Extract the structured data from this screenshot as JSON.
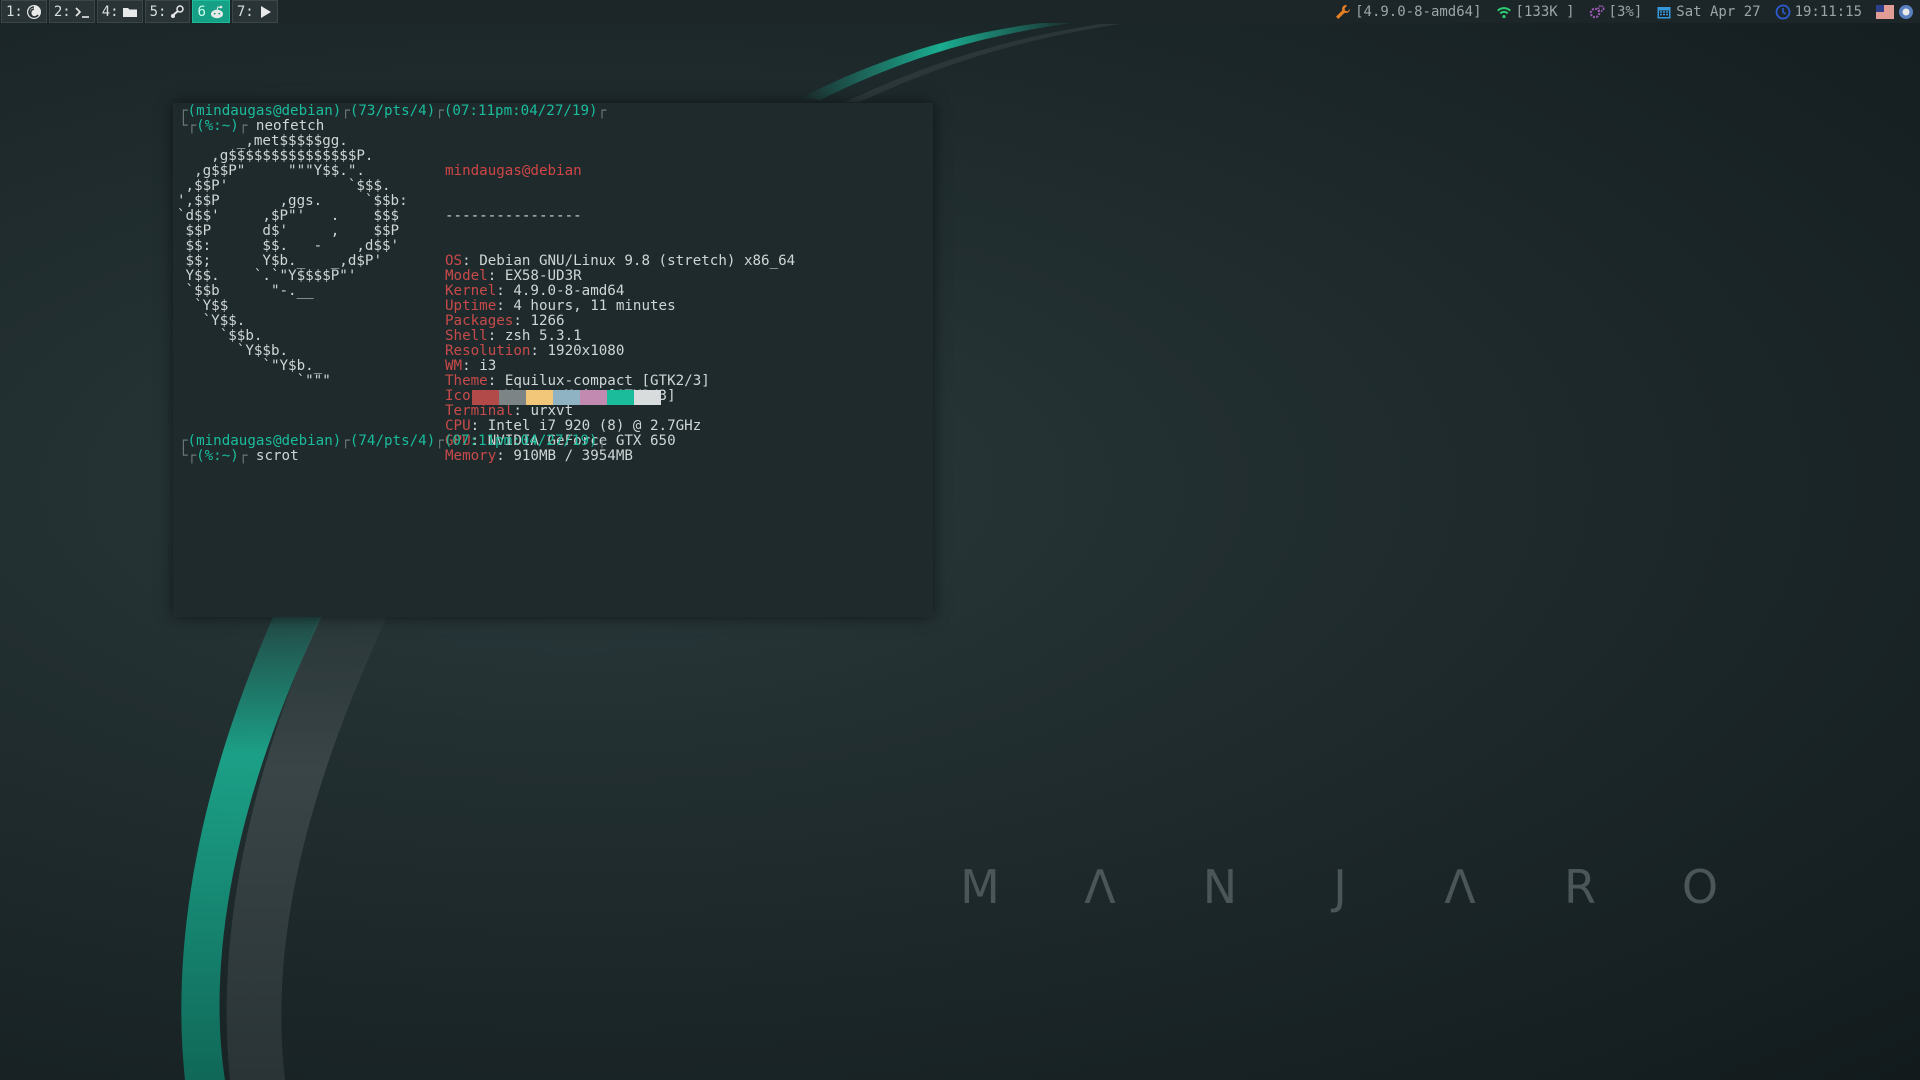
{
  "bar": {
    "workspaces": [
      {
        "label": "1:",
        "icon": "debian-swirl-icon",
        "active": false
      },
      {
        "label": "2:",
        "icon": "terminal-prompt-icon",
        "active": false
      },
      {
        "label": "4:",
        "icon": "folder-icon",
        "active": false
      },
      {
        "label": "5:",
        "icon": "steam-icon",
        "active": false
      },
      {
        "label": "6",
        "icon": "reddit-icon",
        "active": true
      },
      {
        "label": "7:",
        "icon": "play-icon",
        "active": false
      }
    ],
    "status": {
      "kernel": "[4.9.0-8-amd64]",
      "wifi": "[133K ]",
      "cpu": "[3%]",
      "date": "Sat Apr 27",
      "time": "19:11:15"
    },
    "colors": {
      "accent": "#16a085"
    }
  },
  "terminal": {
    "prompt1": {
      "user": "(mindaugas@debian)",
      "pts": "(73/pts/4)",
      "stamp": "(07:11pm:04/27/19)",
      "cwd": "(%:~)",
      "command": "neofetch"
    },
    "prompt2": {
      "user": "(mindaugas@debian)",
      "pts": "(74/pts/4)",
      "stamp": "(07:11pm:04/27/19)",
      "cwd": "(%:~)",
      "command": "scrot"
    },
    "neofetch": {
      "title": "mindaugas@debian",
      "separator": "----------------",
      "fields": [
        {
          "key": "OS",
          "value": "Debian GNU/Linux 9.8 (stretch) x86_64"
        },
        {
          "key": "Model",
          "value": "EX58-UD3R"
        },
        {
          "key": "Kernel",
          "value": "4.9.0-8-amd64"
        },
        {
          "key": "Uptime",
          "value": "4 hours, 11 minutes"
        },
        {
          "key": "Packages",
          "value": "1266"
        },
        {
          "key": "Shell",
          "value": "zsh 5.3.1"
        },
        {
          "key": "Resolution",
          "value": "1920x1080"
        },
        {
          "key": "WM",
          "value": "i3"
        },
        {
          "key": "Theme",
          "value": "Equilux-compact [GTK2/3]"
        },
        {
          "key": "Icons",
          "value": "Vertex-Maia [GTK2/3]"
        },
        {
          "key": "Terminal",
          "value": "urxvt"
        },
        {
          "key": "CPU",
          "value": "Intel i7 920 (8) @ 2.7GHz"
        },
        {
          "key": "GPU",
          "value": "NVIDIA GeForce GTX 650"
        },
        {
          "key": "Memory",
          "value": "910MB / 3954MB"
        }
      ],
      "palette": [
        "#b34a4a",
        "#7d8485",
        "#f2c77a",
        "#8fb3c2",
        "#c28ab0",
        "#1abc9c",
        "#d8dcdc"
      ]
    },
    "ascii_lines": [
      "       _,met$$$$$gg.",
      "    ,g$$$$$$$$$$$$$$$P.",
      "  ,g$$P\"     \"\"\"Y$$.\".",
      " ,$$P'              `$$$.",
      "',$$P       ,ggs.     `$$b:",
      "`d$$'     ,$P\"'   .    $$$",
      " $$P      d$'     ,    $$P",
      " $$:      $$.   -    ,d$$'",
      " $$;      Y$b._   _,d$P'",
      " Y$$.    `.`\"Y$$$$P\"'",
      " `$$b      \"-.__",
      "  `Y$$",
      "   `Y$$.",
      "     `$$b.",
      "       `Y$$b.",
      "          `\"Y$b._",
      "              `\"\"\""
    ]
  },
  "wallpaper": {
    "wordmark": [
      "M",
      "Λ",
      "N",
      "J",
      "Λ",
      "R",
      "O"
    ]
  }
}
